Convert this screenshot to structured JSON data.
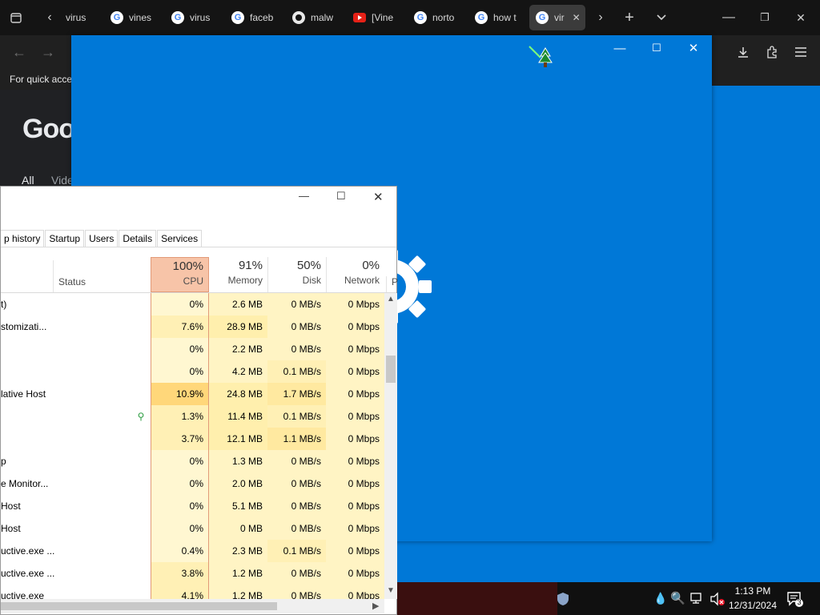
{
  "browser": {
    "tabs": [
      {
        "label": "virus",
        "icon": "google-icon"
      },
      {
        "label": "vines",
        "icon": "google-icon"
      },
      {
        "label": "virus",
        "icon": "google-icon"
      },
      {
        "label": "faceb",
        "icon": "google-icon"
      },
      {
        "label": "malw",
        "icon": "github-icon"
      },
      {
        "label": "[Vine",
        "icon": "youtube-icon"
      },
      {
        "label": "norto",
        "icon": "google-icon"
      },
      {
        "label": "how t",
        "icon": "google-icon"
      },
      {
        "label": "vir",
        "icon": "google-icon"
      }
    ],
    "bookmarks_hint": "For quick acce",
    "google_logo": "Goog",
    "google_tab_all": "All",
    "google_tab_videos": "Vide"
  },
  "task_manager": {
    "tabs": [
      "p history",
      "Startup",
      "Users",
      "Details",
      "Services"
    ],
    "columns": {
      "status": "Status",
      "cpu": {
        "pct": "100%",
        "label": "CPU"
      },
      "memory": {
        "pct": "91%",
        "label": "Memory"
      },
      "disk": {
        "pct": "50%",
        "label": "Disk"
      },
      "network": {
        "pct": "0%",
        "label": "Network"
      },
      "power_partial": "P"
    },
    "rows": [
      {
        "name": "t)",
        "status": "",
        "cpu": "0%",
        "memory": "2.6 MB",
        "disk": "0 MB/s",
        "network": "0 Mbps"
      },
      {
        "name": "stomizati...",
        "status": "",
        "cpu": "7.6%",
        "memory": "28.9 MB",
        "disk": "0 MB/s",
        "network": "0 Mbps"
      },
      {
        "name": "",
        "status": "",
        "cpu": "0%",
        "memory": "2.2 MB",
        "disk": "0 MB/s",
        "network": "0 Mbps"
      },
      {
        "name": "",
        "status": "",
        "cpu": "0%",
        "memory": "4.2 MB",
        "disk": "0.1 MB/s",
        "network": "0 Mbps"
      },
      {
        "name": "lative Host",
        "status": "",
        "cpu": "10.9%",
        "memory": "24.8 MB",
        "disk": "1.7 MB/s",
        "network": "0 Mbps"
      },
      {
        "name": "",
        "status": "leaf",
        "cpu": "1.3%",
        "memory": "11.4 MB",
        "disk": "0.1 MB/s",
        "network": "0 Mbps"
      },
      {
        "name": "",
        "status": "",
        "cpu": "3.7%",
        "memory": "12.1 MB",
        "disk": "1.1 MB/s",
        "network": "0 Mbps"
      },
      {
        "name": "p",
        "status": "",
        "cpu": "0%",
        "memory": "1.3 MB",
        "disk": "0 MB/s",
        "network": "0 Mbps"
      },
      {
        "name": "e Monitor...",
        "status": "",
        "cpu": "0%",
        "memory": "2.0 MB",
        "disk": "0 MB/s",
        "network": "0 Mbps"
      },
      {
        "name": "Host",
        "status": "",
        "cpu": "0%",
        "memory": "5.1 MB",
        "disk": "0 MB/s",
        "network": "0 Mbps"
      },
      {
        "name": "Host",
        "status": "",
        "cpu": "0%",
        "memory": "0 MB",
        "disk": "0 MB/s",
        "network": "0 Mbps"
      },
      {
        "name": "uctive.exe ...",
        "status": "",
        "cpu": "0.4%",
        "memory": "2.3 MB",
        "disk": "0.1 MB/s",
        "network": "0 Mbps"
      },
      {
        "name": "uctive.exe ...",
        "status": "",
        "cpu": "3.8%",
        "memory": "1.2 MB",
        "disk": "0 MB/s",
        "network": "0 Mbps"
      },
      {
        "name": "uctive.exe",
        "status": "",
        "cpu": "4.1%",
        "memory": "1.2 MB",
        "disk": "0 MB/s",
        "network": "0 Mbps"
      }
    ]
  },
  "tray": {
    "time": "1:13 PM",
    "date": "12/31/2024",
    "notification_count": "3"
  },
  "colors": {
    "blue": "#0078d7",
    "cpu_header": "#f7c4a8",
    "cpu_cell": "#fff4c4",
    "cell_light": "#fff4c4",
    "cell_mid": "#ffe9a0"
  }
}
